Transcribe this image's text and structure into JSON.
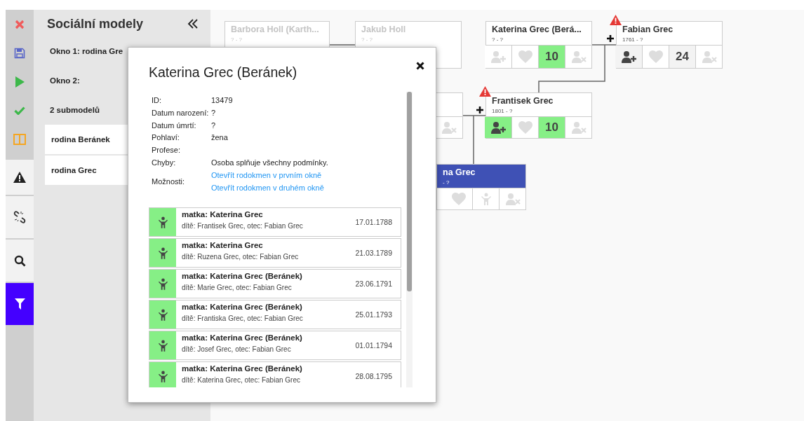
{
  "toolbar": {
    "panels": [
      {
        "kind": "warning",
        "selected": false
      },
      {
        "kind": "unlink",
        "selected": false
      },
      {
        "kind": "search",
        "selected": false
      },
      {
        "kind": "filter",
        "selected": true
      }
    ]
  },
  "sidebar": {
    "title": "Sociální modely",
    "windows": [
      "Okno 1: rodina Gre",
      "Okno 2:"
    ],
    "count": "2 submodelů",
    "submodels": [
      "rodina Beránek",
      "rodina Grec"
    ]
  },
  "tree": {
    "nodes": [
      {
        "name": "Barbora Holl (Karth...",
        "dates": "? - ?",
        "disabled": true,
        "selected": false,
        "warning": false
      },
      {
        "name": "Jakub Holl",
        "dates": "? - ?",
        "disabled": true,
        "selected": false,
        "warning": false
      },
      {
        "name": "Katerina Grec (Berá...",
        "dates": "? - ?",
        "disabled": false,
        "selected": false,
        "warning": false,
        "cells": [
          {
            "kind": "add",
            "highlighted": false,
            "disabled": true
          },
          {
            "kind": "heart",
            "highlighted": false,
            "disabled": true
          },
          {
            "kind": "count",
            "label": "10",
            "highlighted": true,
            "disabled": false
          },
          {
            "kind": "remove",
            "highlighted": false,
            "disabled": true
          }
        ]
      },
      {
        "name": "Fabian Grec",
        "dates": "1761 - ?",
        "disabled": false,
        "selected": false,
        "warning": true,
        "cells": [
          {
            "kind": "add",
            "highlighted": false,
            "disabled": false
          },
          {
            "kind": "heart",
            "highlighted": false,
            "disabled": true
          },
          {
            "kind": "count",
            "label": "24",
            "highlighted": false,
            "disabled": false
          },
          {
            "kind": "remove",
            "highlighted": false,
            "disabled": true
          }
        ]
      },
      {
        "disabled": false,
        "selected": false,
        "warning": false,
        "cells": [
          {
            "kind": "remove",
            "highlighted": false,
            "disabled": true
          }
        ]
      },
      {
        "name": "Frantisek Grec",
        "dates": "1801 - ?",
        "disabled": false,
        "selected": false,
        "warning": true,
        "cells": [
          {
            "kind": "add",
            "highlighted": true,
            "disabled": false
          },
          {
            "kind": "heart",
            "highlighted": false,
            "disabled": true
          },
          {
            "kind": "count",
            "label": "10",
            "highlighted": true,
            "disabled": false
          },
          {
            "kind": "remove",
            "highlighted": false,
            "disabled": true
          }
        ]
      },
      {
        "name": "na Grec",
        "dates": "- ?",
        "disabled": false,
        "selected": true,
        "warning": false,
        "cells": [
          {
            "kind": "heart",
            "highlighted": false,
            "disabled": true
          },
          {
            "kind": "child",
            "highlighted": false,
            "disabled": true
          },
          {
            "kind": "remove",
            "highlighted": false,
            "disabled": true
          }
        ]
      }
    ]
  },
  "detail": {
    "title": "Katerina Grec (Beránek)",
    "info": [
      {
        "label": "ID:",
        "value": "13479"
      },
      {
        "label": "Datum narození:",
        "value": "?"
      },
      {
        "label": "Datum úmrtí:",
        "value": "?"
      },
      {
        "label": "Pohlaví:",
        "value": "žena"
      },
      {
        "label": "Profese:"
      },
      {
        "label": "Chyby:",
        "value": "Osoba splňuje všechny podmínky."
      },
      {
        "label": "Možnosti:",
        "links": [
          "Otevřít rodokmen v prvním okně",
          "Otevřít rodokmen v druhém okně"
        ]
      }
    ],
    "events": [
      {
        "title": "matka: Katerina Grec",
        "detail": "dítě: Frantisek Grec, otec: Fabian Grec",
        "date": "17.01.1788"
      },
      {
        "title": "matka: Katerina Grec",
        "detail": "dítě: Ruzena Grec, otec: Fabian Grec",
        "date": "21.03.1789"
      },
      {
        "title": "matka: Katerina Grec (Beránek)",
        "detail": "dítě: Marie Grec, otec: Fabian Grec",
        "date": "23.06.1791"
      },
      {
        "title": "matka: Katerina Grec (Beránek)",
        "detail": "dítě: Frantiska Grec, otec: Fabian Grec",
        "date": "25.01.1793"
      },
      {
        "title": "matka: Katerina Grec (Beránek)",
        "detail": "dítě: Josef Grec, otec: Fabian Grec",
        "date": "01.01.1794"
      },
      {
        "title": "matka: Katerina Grec (Beránek)",
        "detail": "dítě: Katerina Grec, otec: Fabian Grec",
        "date": "28.08.1795"
      }
    ]
  }
}
